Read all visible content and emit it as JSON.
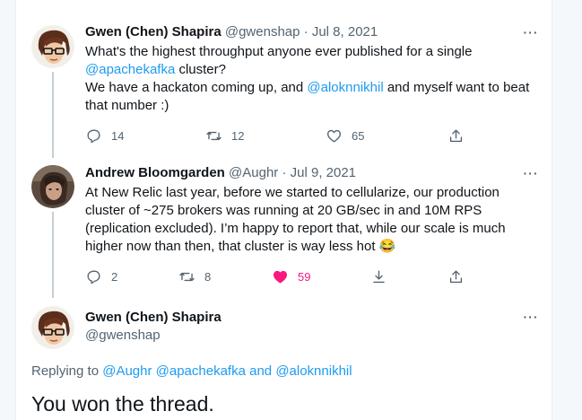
{
  "tweet1": {
    "name": "Gwen (Chen) Shapira",
    "handle": "@gwenshap",
    "separator": "·",
    "date": "Jul 8, 2021",
    "more": "···",
    "line1": "What's the highest throughput anyone ever published for a single",
    "line2_mention": "@apachekafka",
    "line2_rest": " cluster?",
    "line3_a": "We have a hackaton coming up, and ",
    "line3_mention": "@aloknnikhil",
    "line3_b": " and myself want to beat",
    "line4": "that number :)",
    "replies": "14",
    "retweets": "12",
    "likes": "65"
  },
  "tweet2": {
    "name": "Andrew Bloomgarden",
    "handle": "@Aughr",
    "separator": "·",
    "date": "Jul 9, 2021",
    "more": "···",
    "line1": "At New Relic last year, before we started to cellularize, our production",
    "line2": "cluster of ~275 brokers was running at 20 GB/sec in and 10M RPS",
    "line3": "(replication excluded). I’m happy to report that, while our scale is much",
    "line4": "higher now than then, that cluster is way less hot 😂",
    "replies": "2",
    "retweets": "8",
    "likes": "59"
  },
  "main_tweet": {
    "name": "Gwen (Chen) Shapira",
    "handle": "@gwenshap",
    "more": "···",
    "replying_prefix": "Replying to ",
    "replying_mentions": "@Aughr @apachekafka",
    "replying_and": " and ",
    "replying_last": "@aloknnikhil",
    "text": "You won the thread."
  },
  "colors": {
    "accent": "#1d9bf0",
    "like": "#f91880",
    "secondary_text": "#536471"
  },
  "icons": [
    "reply-icon",
    "retweet-icon",
    "like-icon",
    "share-icon",
    "more-icon"
  ]
}
